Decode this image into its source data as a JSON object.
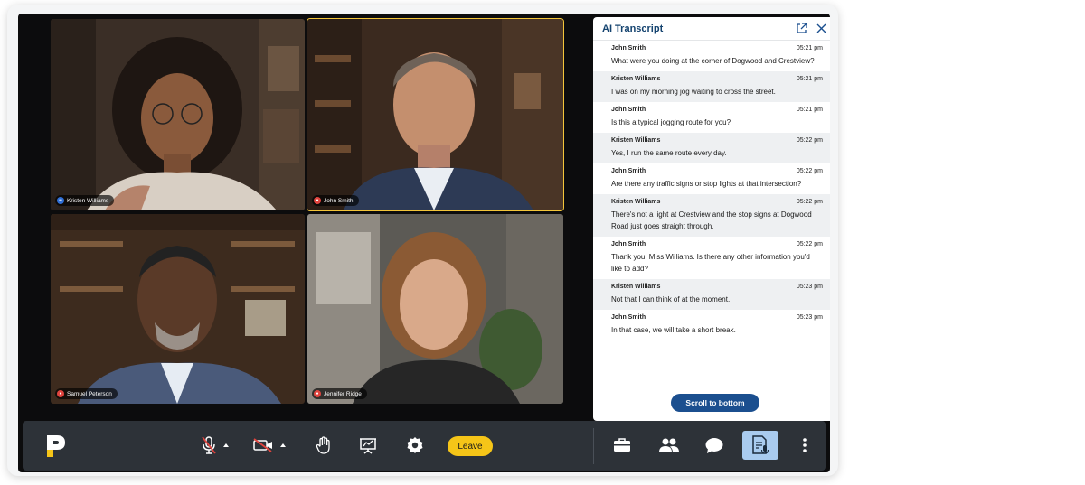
{
  "participants": [
    {
      "name": "Kristen Williams",
      "status": "audio"
    },
    {
      "name": "John Smith",
      "status": "muted"
    },
    {
      "name": "Samuel Peterson",
      "status": "muted"
    },
    {
      "name": "Jennifer Ridge",
      "status": "muted"
    }
  ],
  "transcript": {
    "title": "AI Transcript",
    "scroll_label": "Scroll to bottom",
    "messages": [
      {
        "speaker": "John Smith",
        "time": "05:21 pm",
        "text": "What were you doing at the corner of Dogwood and Crestview?"
      },
      {
        "speaker": "Kristen Williams",
        "time": "05:21 pm",
        "text": "I was on my morning jog waiting to cross the street."
      },
      {
        "speaker": "John Smith",
        "time": "05:21 pm",
        "text": "Is this a typical jogging route for you?"
      },
      {
        "speaker": "Kristen Williams",
        "time": "05:22 pm",
        "text": "Yes, I run the same route every day."
      },
      {
        "speaker": "John Smith",
        "time": "05:22 pm",
        "text": "Are there any traffic signs or stop lights at that intersection?"
      },
      {
        "speaker": "Kristen Williams",
        "time": "05:22 pm",
        "text": "There's not a light at Crestview and the stop signs at Dogwood Road just goes straight through."
      },
      {
        "speaker": "John Smith",
        "time": "05:22 pm",
        "text": "Thank you, Miss Williams. Is there any other information you'd like to add?"
      },
      {
        "speaker": "Kristen Williams",
        "time": "05:23 pm",
        "text": "Not that I can think of at the moment."
      },
      {
        "speaker": "John Smith",
        "time": "05:23 pm",
        "text": "In that case, we will take a short break."
      }
    ]
  },
  "toolbar": {
    "leave_label": "Leave",
    "logo_letter": "P"
  },
  "colors": {
    "accent_yellow": "#f5c518",
    "transcript_blue": "#1b4f8f",
    "toolbar_bg": "#2d3238",
    "active_tool": "#a9cbef",
    "muted_red": "#e0443e"
  },
  "icons": [
    "logo-icon",
    "mic-off-icon",
    "camera-off-icon",
    "raise-hand-icon",
    "present-icon",
    "settings-icon",
    "briefcase-icon",
    "participants-icon",
    "chat-icon",
    "transcript-icon",
    "more-icon",
    "popout-icon",
    "close-icon"
  ]
}
